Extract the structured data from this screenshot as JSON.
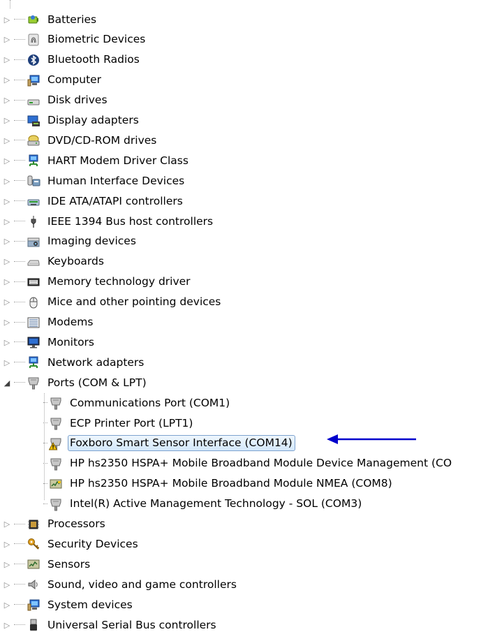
{
  "tree": {
    "categories_before": [
      {
        "label": "Batteries",
        "icon": "battery-icon"
      },
      {
        "label": "Biometric Devices",
        "icon": "fingerprint-icon"
      },
      {
        "label": "Bluetooth Radios",
        "icon": "bluetooth-icon"
      },
      {
        "label": "Computer",
        "icon": "computer-icon"
      },
      {
        "label": "Disk drives",
        "icon": "disk-drive-icon"
      },
      {
        "label": "Display adapters",
        "icon": "display-adapter-icon"
      },
      {
        "label": "DVD/CD-ROM drives",
        "icon": "dvd-drive-icon"
      },
      {
        "label": "HART Modem Driver Class",
        "icon": "network-device-icon"
      },
      {
        "label": "Human Interface Devices",
        "icon": "hid-icon"
      },
      {
        "label": "IDE ATA/ATAPI controllers",
        "icon": "ide-controller-icon"
      },
      {
        "label": "IEEE 1394 Bus host controllers",
        "icon": "firewire-icon"
      },
      {
        "label": "Imaging devices",
        "icon": "scanner-icon"
      },
      {
        "label": "Keyboards",
        "icon": "keyboard-icon"
      },
      {
        "label": "Memory technology driver",
        "icon": "memory-icon"
      },
      {
        "label": "Mice and other pointing devices",
        "icon": "mouse-icon"
      },
      {
        "label": "Modems",
        "icon": "modem-icon"
      },
      {
        "label": "Monitors",
        "icon": "monitor-icon"
      },
      {
        "label": "Network adapters",
        "icon": "network-adapter-icon"
      }
    ],
    "ports": {
      "label": "Ports (COM & LPT)",
      "icon": "port-icon",
      "children": [
        {
          "label": "Communications Port (COM1)",
          "icon": "port-icon",
          "warning": false,
          "selected": false
        },
        {
          "label": "ECP Printer Port (LPT1)",
          "icon": "port-icon",
          "warning": false,
          "selected": false
        },
        {
          "label": "Foxboro Smart Sensor Interface (COM14)",
          "icon": "port-warning-icon",
          "warning": true,
          "selected": true
        },
        {
          "label": "HP hs2350 HSPA+ Mobile Broadband Module Device Management (CO",
          "icon": "port-icon",
          "warning": false,
          "selected": false
        },
        {
          "label": "HP hs2350 HSPA+ Mobile Broadband Module NMEA (COM8)",
          "icon": "sensor-port-icon",
          "warning": false,
          "selected": false
        },
        {
          "label": "Intel(R) Active Management Technology - SOL (COM3)",
          "icon": "port-icon",
          "warning": false,
          "selected": false
        }
      ]
    },
    "categories_after": [
      {
        "label": "Processors",
        "icon": "processor-icon"
      },
      {
        "label": "Security Devices",
        "icon": "security-key-icon"
      },
      {
        "label": "Sensors",
        "icon": "sensor-icon"
      },
      {
        "label": "Sound, video and game controllers",
        "icon": "speaker-icon"
      },
      {
        "label": "System devices",
        "icon": "computer-icon"
      },
      {
        "label": "Universal Serial Bus controllers",
        "icon": "usb-icon"
      }
    ]
  },
  "annotation": {
    "arrow_color": "#0000cc",
    "selection_border": "#7da2ce",
    "warning_color": "#f5c400"
  }
}
